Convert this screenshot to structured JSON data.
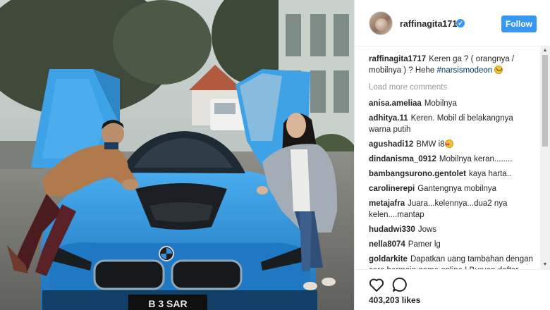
{
  "post": {
    "username": "raffinagita1717",
    "follow_label": "Follow",
    "caption_user": "raffinagita1717",
    "caption_text": "Keren ga ? ( orangnya / mobilnya ) ? Hehe ",
    "caption_tag": "#narsismodeon",
    "load_more": "Load more comments",
    "likes": "403,203 likes",
    "license_plate": "B 3 SAR"
  },
  "comments": [
    {
      "user": "anisa.ameliaa",
      "text": "Mobilnya"
    },
    {
      "user": "adhitya.11",
      "text": "Keren. Mobil di belakangnya warna putih"
    },
    {
      "user": "agushadi12",
      "text": "BMW i8"
    },
    {
      "user": "dindanisma_0912",
      "text": "Mobilnya keran........"
    },
    {
      "user": "bambangsurono.gentolet",
      "text": "kaya harta.."
    },
    {
      "user": "carolinerepi",
      "text": "Gantengnya mobilnya"
    },
    {
      "user": "metajafra",
      "text": "Juara...kelennya...dua2 nya kelen....mantap"
    },
    {
      "user": "hudadwi330",
      "text": "Jows"
    },
    {
      "user": "nella8074",
      "text": "Pamer lg"
    },
    {
      "user": "goldarkite",
      "text": "Dapatkan uang tambahan dengan cara bermain game online ! Buruan daftar disini ! http://www.agenpokerbio.add"
    }
  ],
  "icons": {
    "verified": "verified-badge-icon",
    "like": "heart-icon",
    "comment": "comment-icon",
    "caption_emoji": "smiling-face-emoji",
    "comment_emoji": "heart-eyes-emoji"
  },
  "colors": {
    "accent": "#3897f0",
    "car": "#2d8fd6",
    "tag": "#003569"
  }
}
